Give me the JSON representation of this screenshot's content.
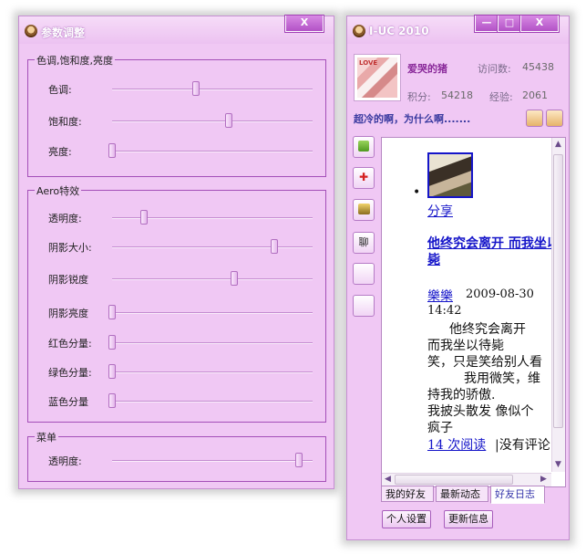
{
  "settings_window": {
    "title": "参数调整",
    "close_glyph": "X",
    "groups": [
      {
        "title": "色调,饱和度,亮度",
        "sliders": [
          {
            "label": "色调:",
            "value": 0.42
          },
          {
            "label": "饱和度:",
            "value": 0.58
          },
          {
            "label": "亮度:",
            "value": 0.0
          }
        ]
      },
      {
        "title": "Aero特效",
        "sliders": [
          {
            "label": "透明度:",
            "value": 0.16
          },
          {
            "label": "阴影大小:",
            "value": 0.81
          },
          {
            "label": "阴影锐度",
            "value": 0.61
          },
          {
            "label": "阴影亮度",
            "value": 0.0
          },
          {
            "label": "红色分量:",
            "value": 0.0
          },
          {
            "label": "绿色分量:",
            "value": 0.0
          },
          {
            "label": "蓝色分量",
            "value": 0.0
          }
        ]
      },
      {
        "title": "菜单",
        "sliders": [
          {
            "label": "透明度:",
            "value": 0.93
          }
        ]
      }
    ]
  },
  "uc_window": {
    "title": "I-UC 2010",
    "min_glyph": "—",
    "max_glyph": "□",
    "close_glyph": "X",
    "profile": {
      "avatar_tag": "LOVE",
      "nickname": "爱哭的猪",
      "visits_label": "访问数:",
      "visits_value": "45438",
      "points_label": "积分:",
      "points_value": "54218",
      "exp_label": "经验:",
      "exp_value": "2061"
    },
    "signature": "超冷的啊，为什么啊.......",
    "side_buttons": [
      "",
      "✚",
      "",
      "聊",
      "",
      ""
    ],
    "feed": {
      "share_link": "分享",
      "post_title": "他终究会离开 而我坐以待毙",
      "author": "樂樂",
      "date": "2009-08-30",
      "time": "14:42",
      "lines": [
        "他终究会离开",
        "而我坐以待毙",
        "笑，只是笑给别人看",
        "我用微笑，维",
        "持我的骄傲.",
        "我披头散发 像似个",
        "疯子"
      ],
      "reads_link": "14 次阅读",
      "comment_text": "|没有评论"
    },
    "tabs": [
      "我的好友",
      "最新动态",
      "好友日志"
    ],
    "active_tab": 2,
    "footer_buttons": [
      "个人设置",
      "更新信息"
    ]
  },
  "colors": {
    "window_bg": "#f0c8f4",
    "accent": "#b252c6",
    "link": "#1515c9"
  }
}
